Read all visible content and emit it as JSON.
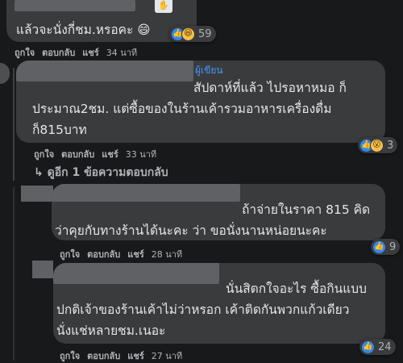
{
  "comments": [
    {
      "text_lines": [
        "แล้วจะนั่งกี่ชม.หรอคะ 😄"
      ],
      "reaction_count": "59",
      "actions": {
        "like": "ถูกใจ",
        "reply": "ตอบกลับ",
        "share": "แชร์",
        "time": "34 นาที"
      }
    },
    {
      "author_badge": "ผู้เขียน",
      "text_lines": [
        "สัปดาห์ที่แล้ว ไปรอหาหมอ ก็",
        "ประมาณ2ชม. แต่ซื้อของในร้านเค้ารวมอาหารเครื่องดื่ม",
        "ก็815บาท"
      ],
      "reaction_count": "3",
      "actions": {
        "like": "ถูกใจ",
        "reply": "ตอบกลับ",
        "share": "แชร์",
        "time": "33 นาที"
      }
    },
    {
      "text_lines": [
        "ถ้าจ่ายในราคา 815 คิด",
        "ว่าคุยกับทางร้านได้นะคะ ว่า ขอนั่งนานหน่อยนะคะ"
      ],
      "reaction_count": "9",
      "actions": {
        "like": "ถูกใจ",
        "reply": "ตอบกลับ",
        "share": "แชร์",
        "time": "28 นาที"
      }
    },
    {
      "text_lines": [
        "นั่นสิตกใจอะไร ซื้อกินแบบ",
        "ปกติเจ้าของร้านเค้าไม่ว่าหรอก เค้าติดกันพวกแก้วเดียว",
        "นั่งแช่หลายชม.เนอะ"
      ],
      "reaction_count": "24",
      "actions": {
        "like": "ถูกใจ",
        "reply": "ตอบกลับ",
        "share": "แชร์",
        "time": "27 นาที"
      }
    }
  ],
  "view_more_replies": "↳ ดูอีก 1 ข้อความตอบกลับ",
  "colors": {
    "background": "#18191a",
    "bubble": "#3a3b3c",
    "text": "#e4e6eb",
    "muted": "#b0b3b8",
    "badge": "#4599ff"
  }
}
